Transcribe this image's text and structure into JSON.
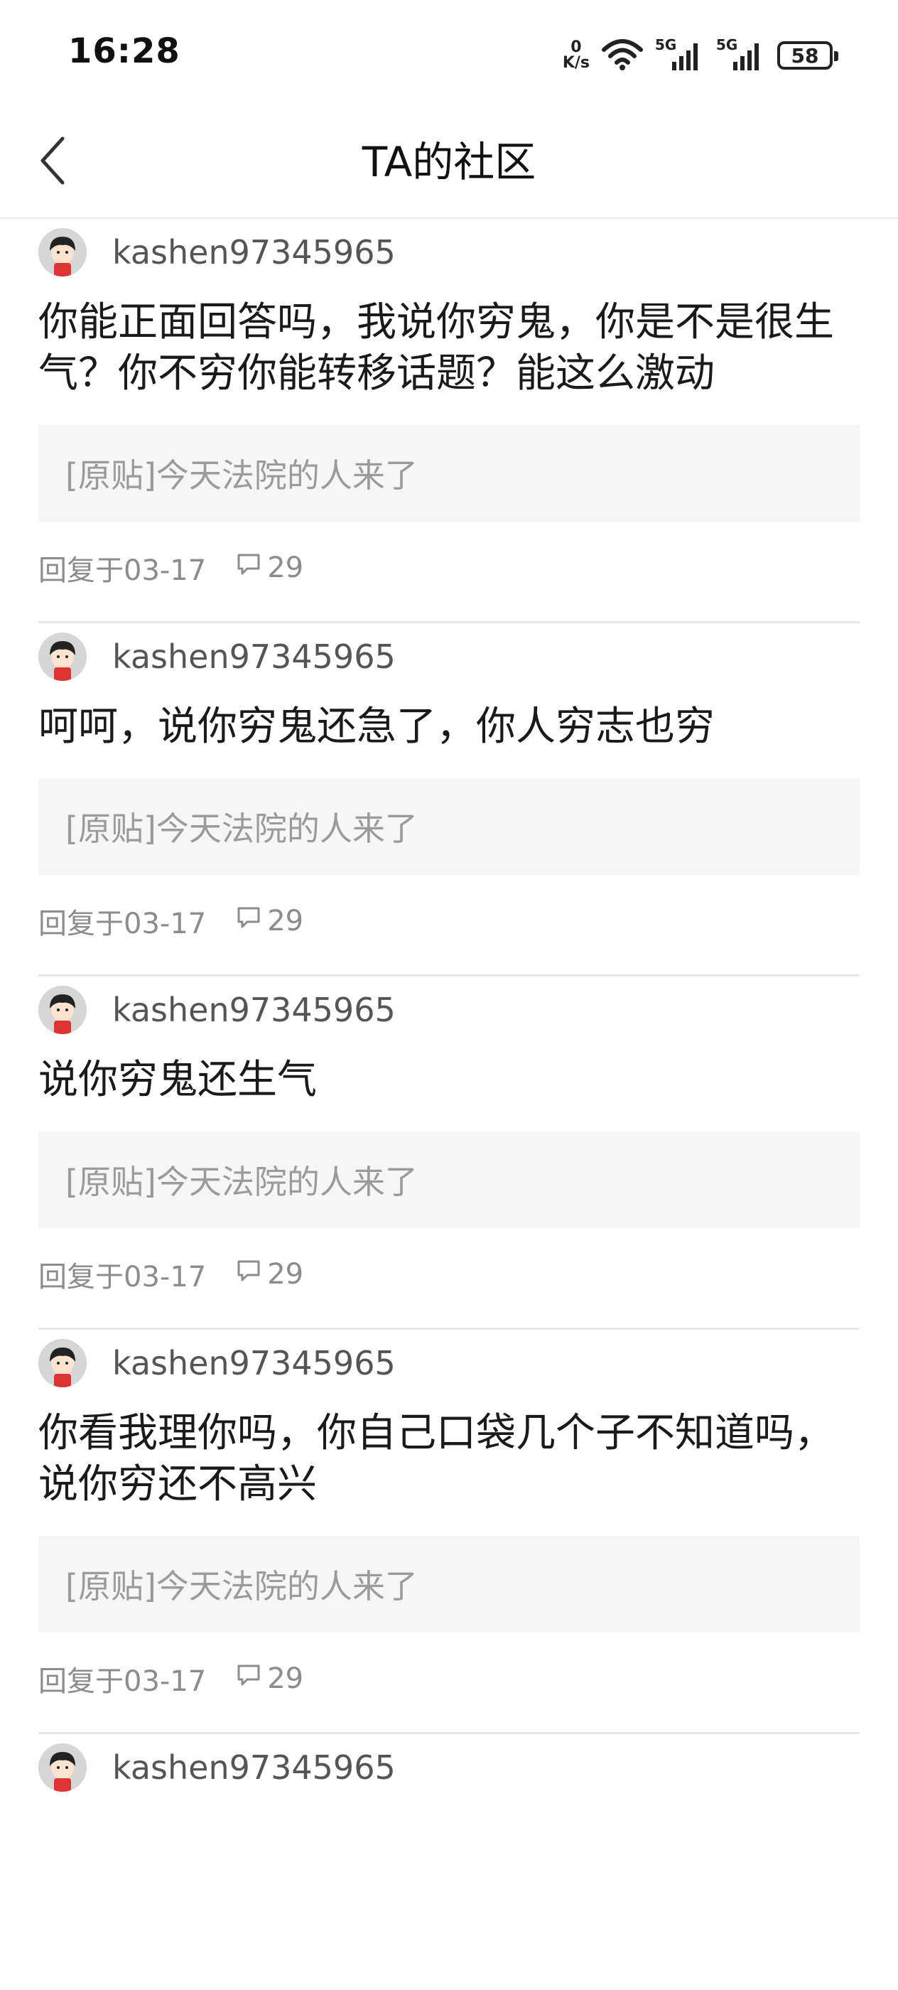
{
  "status_bar": {
    "time": "16:28",
    "net_speed_value": "0",
    "net_speed_unit": "K/s",
    "signal_1_label": "5G",
    "signal_2_label": "5G",
    "battery": "58"
  },
  "header": {
    "title": "TA的社区"
  },
  "posts": [
    {
      "username": "kashen97345965",
      "content": "你能正面回答吗，我说你穷鬼，你是不是很生气？你不穷你能转移话题？能这么激动",
      "quote": "[原贴]今天法院的人来了",
      "reply_date": "回复于03-17",
      "comment_count": "29"
    },
    {
      "username": "kashen97345965",
      "content": "呵呵，说你穷鬼还急了，你人穷志也穷",
      "quote": "[原贴]今天法院的人来了",
      "reply_date": "回复于03-17",
      "comment_count": "29"
    },
    {
      "username": "kashen97345965",
      "content": "说你穷鬼还生气",
      "quote": "[原贴]今天法院的人来了",
      "reply_date": "回复于03-17",
      "comment_count": "29"
    },
    {
      "username": "kashen97345965",
      "content": "你看我理你吗，你自己口袋几个子不知道吗，说你穷还不高兴",
      "quote": "[原贴]今天法院的人来了",
      "reply_date": "回复于03-17",
      "comment_count": "29"
    },
    {
      "username": "kashen97345965"
    }
  ],
  "icons": {
    "back": "chevron-left-icon",
    "comment": "comment-bubble-icon",
    "wifi": "wifi-icon",
    "signal": "cellular-signal-icon",
    "battery": "battery-icon"
  }
}
